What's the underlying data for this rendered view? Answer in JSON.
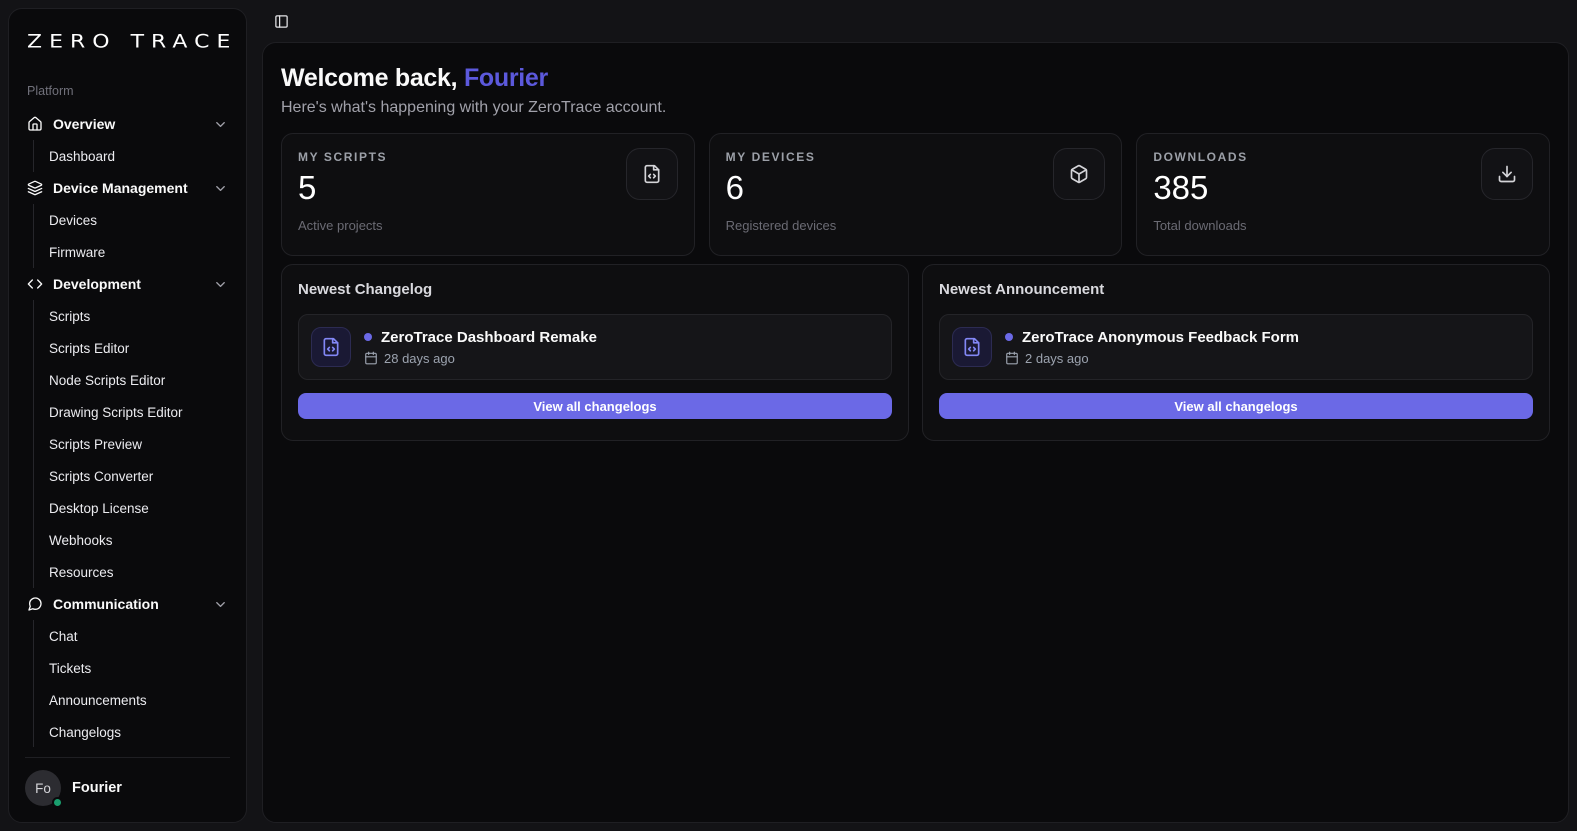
{
  "brand": {
    "logo_text": "ZERO TRACE"
  },
  "sidebar": {
    "section_label": "Platform",
    "groups": [
      {
        "label": "Overview",
        "icon": "house-icon",
        "children": [
          "Dashboard"
        ]
      },
      {
        "label": "Device Management",
        "icon": "layers-icon",
        "children": [
          "Devices",
          "Firmware"
        ]
      },
      {
        "label": "Development",
        "icon": "code-icon",
        "children": [
          "Scripts",
          "Scripts Editor",
          "Node Scripts Editor",
          "Drawing Scripts Editor",
          "Scripts Preview",
          "Scripts Converter",
          "Desktop License",
          "Webhooks",
          "Resources"
        ]
      },
      {
        "label": "Communication",
        "icon": "chat-icon",
        "children": [
          "Chat",
          "Tickets",
          "Announcements",
          "Changelogs"
        ]
      }
    ],
    "user": {
      "initials": "Fo",
      "name": "Fourier",
      "status": "online"
    }
  },
  "header": {
    "greeting_prefix": "Welcome back,",
    "user_name": "Fourier",
    "subtitle": "Here's what's happening with your ZeroTrace account."
  },
  "stats": [
    {
      "label": "MY SCRIPTS",
      "value": "5",
      "description": "Active projects",
      "icon": "file-code-icon"
    },
    {
      "label": "MY DEVICES",
      "value": "6",
      "description": "Registered devices",
      "icon": "package-icon"
    },
    {
      "label": "DOWNLOADS",
      "value": "385",
      "description": "Total downloads",
      "icon": "download-icon"
    }
  ],
  "panels": [
    {
      "title": "Newest Changelog",
      "item": {
        "title": "ZeroTrace Dashboard Remake",
        "time": "28 days ago"
      },
      "button_label": "View all changelogs"
    },
    {
      "title": "Newest Announcement",
      "item": {
        "title": "ZeroTrace Anonymous Feedback Form",
        "time": "2 days ago"
      },
      "button_label": "View all changelogs"
    }
  ],
  "colors": {
    "accent": "#6b69e6",
    "accent_text": "#5c59dc",
    "status_online": "#1a9e6e"
  }
}
